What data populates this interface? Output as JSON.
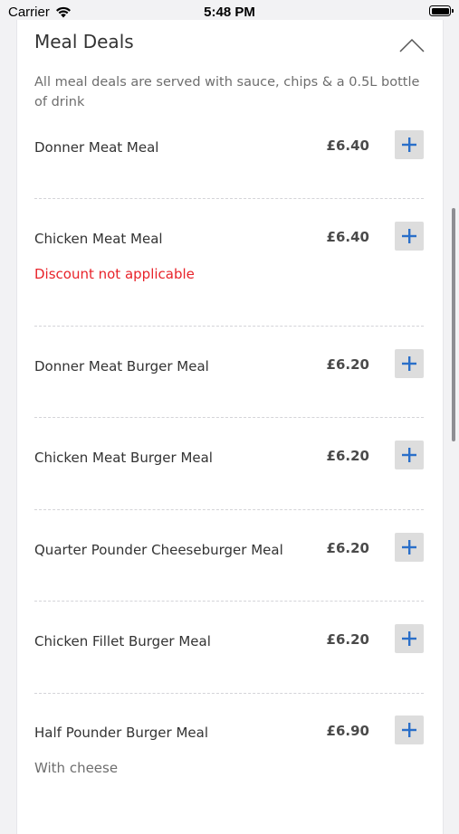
{
  "status_bar": {
    "carrier": "Carrier",
    "time": "5:48 PM"
  },
  "section": {
    "title": "Meal Deals",
    "description": "All meal deals are served with sauce, chips & a 0.5L bottle of drink",
    "collapse_icon": "chevron-up-icon"
  },
  "items": [
    {
      "name": "Donner Meat Meal",
      "price": "£6.40"
    },
    {
      "name": "Chicken Meat Meal",
      "price": "£6.40",
      "note": "Discount not applicable"
    },
    {
      "name": "Donner Meat Burger Meal",
      "price": "£6.20"
    },
    {
      "name": "Chicken Meat Burger Meal",
      "price": "£6.20"
    },
    {
      "name": "Quarter Pounder Cheeseburger Meal",
      "price": "£6.20"
    },
    {
      "name": "Chicken Fillet Burger Meal",
      "price": "£6.20"
    },
    {
      "name": "Half Pounder Burger Meal",
      "price": "£6.90",
      "note": "With cheese"
    }
  ],
  "add_icon": "plus-icon",
  "colors": {
    "accent_blue": "#2a6fc9",
    "note_red": "#e8232a",
    "button_bg": "#dddddd"
  }
}
